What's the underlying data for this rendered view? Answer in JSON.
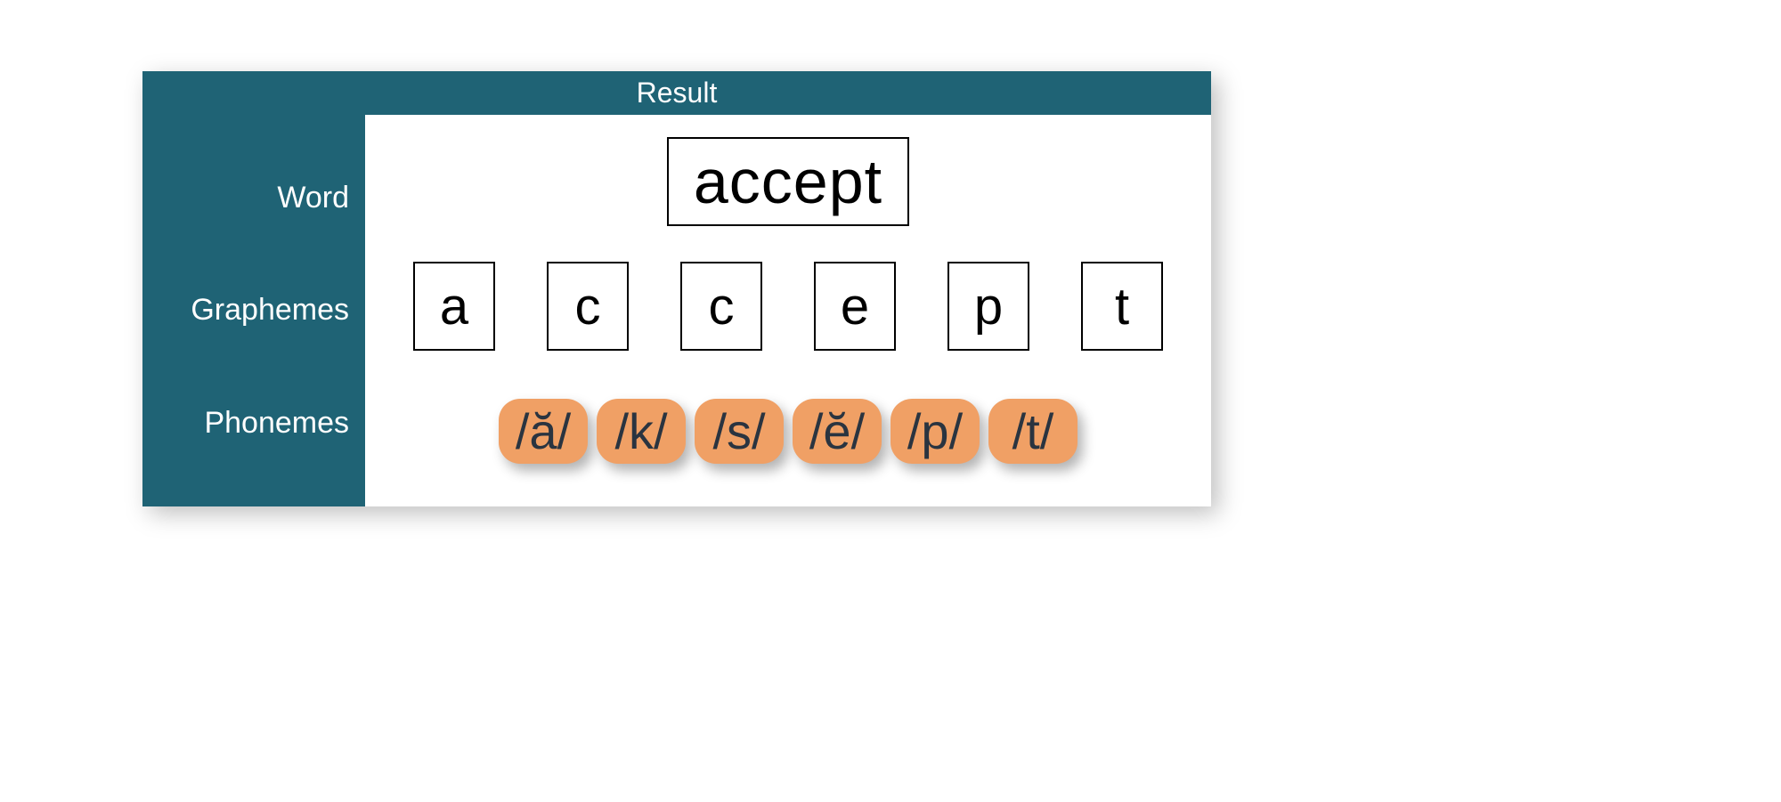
{
  "header": "Result",
  "labels": {
    "word": "Word",
    "graphemes": "Graphemes",
    "phonemes": "Phonemes"
  },
  "word": "accept",
  "graphemes": [
    "a",
    "c",
    "c",
    "e",
    "p",
    "t"
  ],
  "phonemes": [
    "/ă/",
    "/k/",
    "/s/",
    "/ĕ/",
    "/p/",
    "/t/"
  ],
  "colors": {
    "teal": "#1f6375",
    "orange": "#f0a065"
  }
}
